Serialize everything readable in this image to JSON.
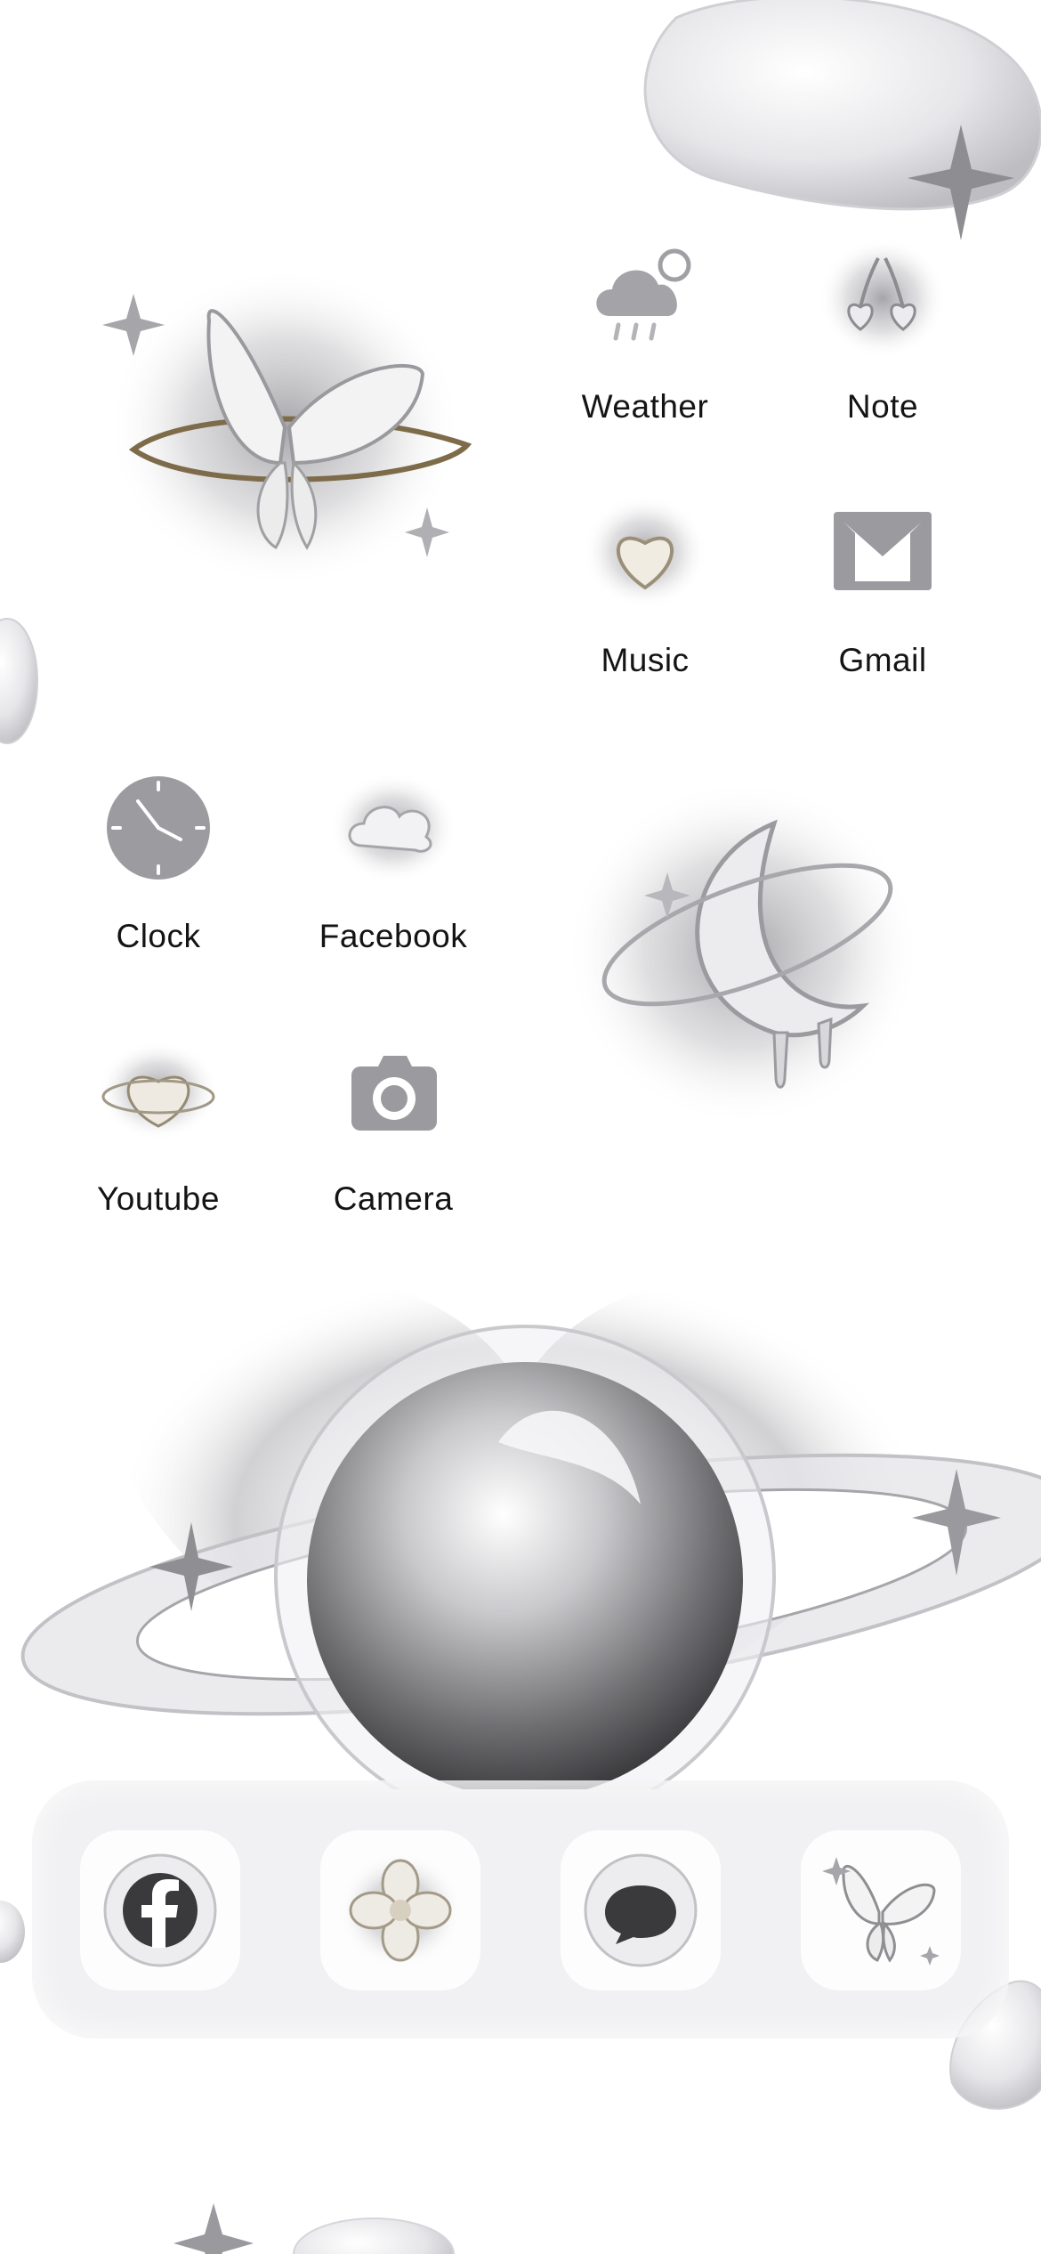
{
  "home_screen": {
    "apps": [
      {
        "label": "Weather",
        "icon": "weather-cloud-rain-icon"
      },
      {
        "label": "Note",
        "icon": "cherry-hearts-icon"
      },
      {
        "label": "Music",
        "icon": "heart-bubble-icon"
      },
      {
        "label": "Gmail",
        "icon": "gmail-envelope-icon"
      },
      {
        "label": "Clock",
        "icon": "clock-icon"
      },
      {
        "label": "Facebook",
        "icon": "cloud-bubble-icon"
      },
      {
        "label": "Youtube",
        "icon": "chrome-heart-icon"
      },
      {
        "label": "Camera",
        "icon": "camera-icon"
      }
    ],
    "widgets": [
      {
        "name": "butterfly-widget",
        "icon": "chrome-butterfly-icon"
      },
      {
        "name": "moon-widget",
        "icon": "chrome-moon-icon"
      },
      {
        "name": "planet-widget",
        "icon": "chrome-planet-icon"
      }
    ]
  },
  "dock": {
    "items": [
      {
        "name": "facebook",
        "icon": "facebook-bubble-icon"
      },
      {
        "name": "flower",
        "icon": "chrome-flower-icon"
      },
      {
        "name": "messages",
        "icon": "speech-bubble-icon"
      },
      {
        "name": "butterfly",
        "icon": "chrome-butterfly-icon"
      }
    ]
  },
  "theme": {
    "background": "#ffffff",
    "label_color": "#141414",
    "icon_silver": "#9a9a9c",
    "glow": "#b8b8bb"
  }
}
